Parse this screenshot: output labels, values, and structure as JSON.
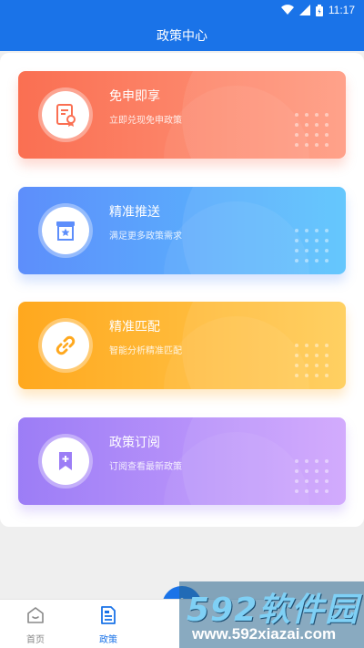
{
  "status_bar": {
    "time": "11:17",
    "icons": [
      "wifi-icon",
      "signal-icon",
      "battery-icon"
    ]
  },
  "header": {
    "title": "政策中心"
  },
  "cards": [
    {
      "title": "免申即享",
      "subtitle": "立即兑现免申政策",
      "icon": "certificate-icon",
      "color": "#fa6f52"
    },
    {
      "title": "精准推送",
      "subtitle": "满足更多政策需求",
      "icon": "star-inbox-icon",
      "color": "#5d8efb"
    },
    {
      "title": "精准匹配",
      "subtitle": "智能分析精准匹配",
      "icon": "link-icon",
      "color": "#ffa81e"
    },
    {
      "title": "政策订阅",
      "subtitle": "订阅查看最新政策",
      "icon": "bookmark-plus-icon",
      "color": "#9c7df6"
    }
  ],
  "bottom_nav": {
    "items": [
      {
        "label": "首页",
        "icon": "home-icon",
        "active": false
      },
      {
        "label": "政策",
        "icon": "document-icon",
        "active": true
      }
    ],
    "fab_icon": "plus-icon",
    "active_color": "#1a73e8"
  },
  "watermark": {
    "brand": "592软件园",
    "url": "www.592xiazai.com"
  }
}
